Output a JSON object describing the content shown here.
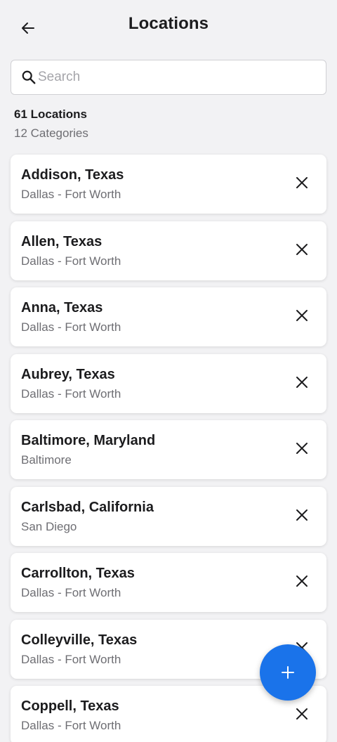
{
  "header": {
    "title": "Locations",
    "back_icon": "arrow-left-icon"
  },
  "search": {
    "placeholder": "Search",
    "value": "",
    "icon": "search-icon"
  },
  "summary": {
    "locations_count": "61 Locations",
    "categories_count": "12 Categories"
  },
  "locations": [
    {
      "name": "Addison, Texas",
      "region": "Dallas - Fort Worth"
    },
    {
      "name": "Allen, Texas",
      "region": "Dallas - Fort Worth"
    },
    {
      "name": "Anna, Texas",
      "region": "Dallas - Fort Worth"
    },
    {
      "name": "Aubrey, Texas",
      "region": "Dallas - Fort Worth"
    },
    {
      "name": "Baltimore, Maryland",
      "region": "Baltimore"
    },
    {
      "name": "Carlsbad, California",
      "region": "San Diego"
    },
    {
      "name": "Carrollton, Texas",
      "region": "Dallas - Fort Worth"
    },
    {
      "name": "Colleyville, Texas",
      "region": "Dallas - Fort Worth"
    },
    {
      "name": "Coppell, Texas",
      "region": "Dallas - Fort Worth"
    }
  ],
  "fab": {
    "icon": "plus-icon"
  },
  "colors": {
    "accent": "#1a73ea",
    "background": "#f2f2f4",
    "card": "#ffffff",
    "text_primary": "#1c1c1e",
    "text_secondary": "#6e6e73"
  }
}
